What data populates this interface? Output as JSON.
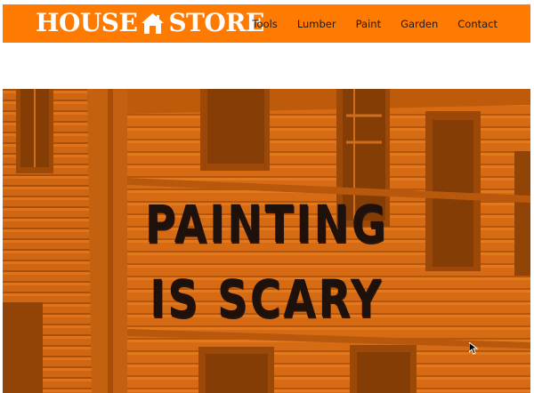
{
  "header": {
    "logo_left": "HOUSE",
    "logo_right": "STORE",
    "logo_icon": "house-icon",
    "background_color": "#ff7a00"
  },
  "nav": {
    "items": [
      {
        "label": "Tools"
      },
      {
        "label": "Lumber"
      },
      {
        "label": "Paint"
      },
      {
        "label": "Garden"
      },
      {
        "label": "Contact"
      }
    ]
  },
  "hero": {
    "title_line1": "PAINTING",
    "title_line2": "IS SCARY",
    "background": "orange-tinted photo of an old abandoned wooden house",
    "tint_color": "#ff7a00",
    "text_color": "#1e100a"
  },
  "cursor": {
    "icon": "mouse-pointer-icon"
  }
}
